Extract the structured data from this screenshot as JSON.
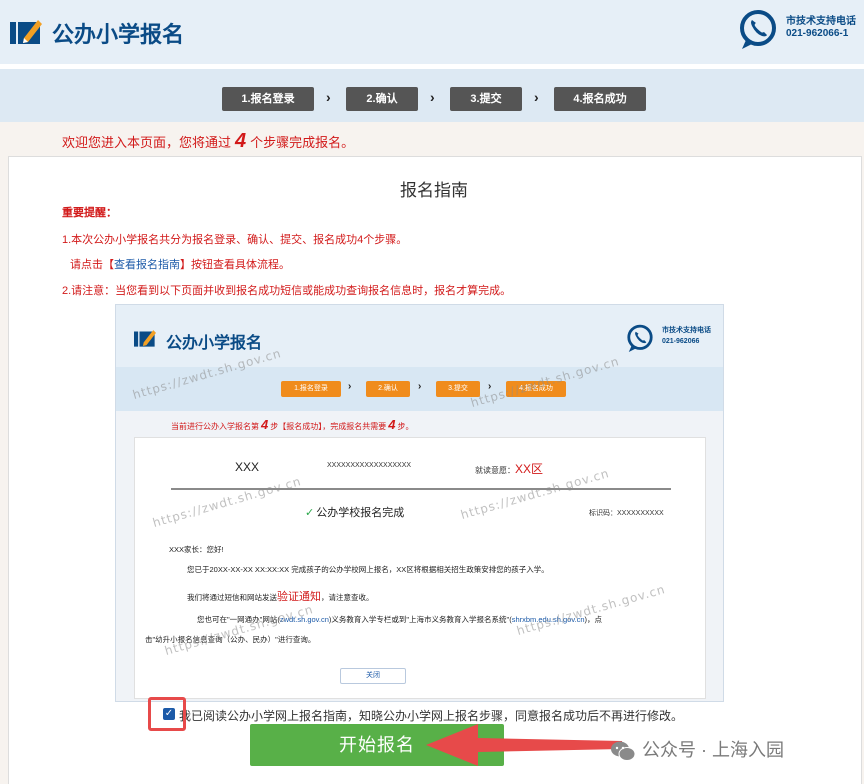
{
  "header": {
    "title": "公办小学报名",
    "support_title": "市技术支持电话",
    "support_number": "021-962066-1"
  },
  "steps": [
    {
      "label": "1.报名登录"
    },
    {
      "label": "2.确认"
    },
    {
      "label": "3.提交"
    },
    {
      "label": "4.报名成功"
    }
  ],
  "welcome": {
    "prefix": "欢迎您进入本页面，您将通过",
    "count": "4",
    "suffix": "个步骤完成报名。"
  },
  "guide": {
    "title": "报名指南",
    "important_label": "重要提醒：",
    "note1": "1.本次公办小学报名共分为报名登录、确认、提交、报名成功4个步骤。",
    "note1b_prefix": "请点击【",
    "note1b_link": "查看报名指南",
    "note1b_suffix": "】按钮查看具体流程。",
    "note2": "2.请注意：当您看到以下页面并收到报名成功短信或能成功查询报名信息时，报名才算完成。"
  },
  "example": {
    "title": "公办小学报名",
    "support_title": "市技术支持电话",
    "support_number": "021-962066",
    "steps": [
      {
        "label": "1.报名登录"
      },
      {
        "label": "2.确认"
      },
      {
        "label": "3.提交"
      },
      {
        "label": "4.报名成功"
      }
    ],
    "current_prefix": "当前进行公办入学报名第",
    "current_step": "4",
    "current_middle": "步【报名成功】，完成报名共需要",
    "total_steps": "4",
    "current_suffix": "步。",
    "student_name": "XXX",
    "student_id": "XXXXXXXXXXXXXXXXXX",
    "school_label": "就读意愿：",
    "school_value": "XX区",
    "done_text": "公办学校报名完成",
    "code_label": "标识码：",
    "code_value": "XXXXXXXXXX",
    "greeting": "XXX家长：您好!",
    "line1": "您已于20XX-XX-XX XX:XX:XX 完成孩子的公办学校网上报名，XX区将根据相关招生政策安排您的孩子入学。",
    "line2_prefix": "我们将通过短信和网站发送",
    "line2_highlight": "验证通知",
    "line2_suffix": "，请注意查收。",
    "line3_prefix": "您也可在\"一网通办\"网站(",
    "line3_link1": "zwdt.sh.gov.cn",
    "line3_middle": ")义务教育入学专栏或到\"上海市义务教育入学报名系统\"(",
    "line3_link2": "shrxbm.edu.sh.gov.cn",
    "line3_suffix": ")，点",
    "line4": "击\"幼升小报名信息查询（公办、民办）\"进行查询。",
    "close_label": "关闭",
    "watermark": "https://zwdt.sh.gov.cn"
  },
  "agreement": {
    "checked": true,
    "text": "我已阅读公办小学网上报名指南，知晓公办小学网上报名步骤，同意报名成功后不再进行修改。"
  },
  "start_button": "开始报名",
  "footer_watermark": "公众号 · 上海入园",
  "colors": {
    "brand_blue": "#0a4b86",
    "alert_red": "#d21a1a",
    "start_green": "#58b048",
    "step_dark": "#555555",
    "example_step_orange": "#f08c1c"
  }
}
